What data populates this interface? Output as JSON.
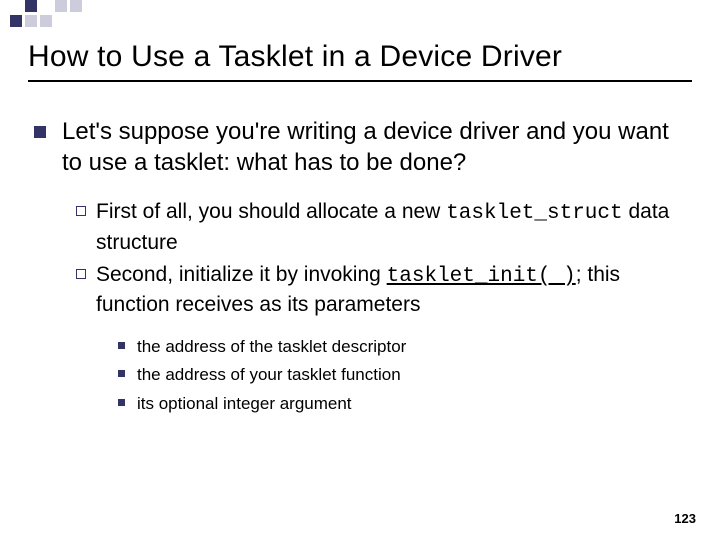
{
  "title": "How to Use a Tasklet in a Device Driver",
  "lvl1": "Let's suppose you're writing a device driver and you want to use a tasklet: what has to be done?",
  "lvl2a_pre": "First of all, you should allocate a new ",
  "lvl2a_code": "tasklet_struct",
  "lvl2a_post": " data structure",
  "lvl2b_pre": "Second, initialize it by invoking ",
  "lvl2b_code": "tasklet_init( )",
  "lvl2b_post": "; this function receives as its parameters",
  "lvl3a": "the address of the tasklet descriptor",
  "lvl3b": "the address of your tasklet function",
  "lvl3c": "its optional integer argument",
  "page": "123"
}
